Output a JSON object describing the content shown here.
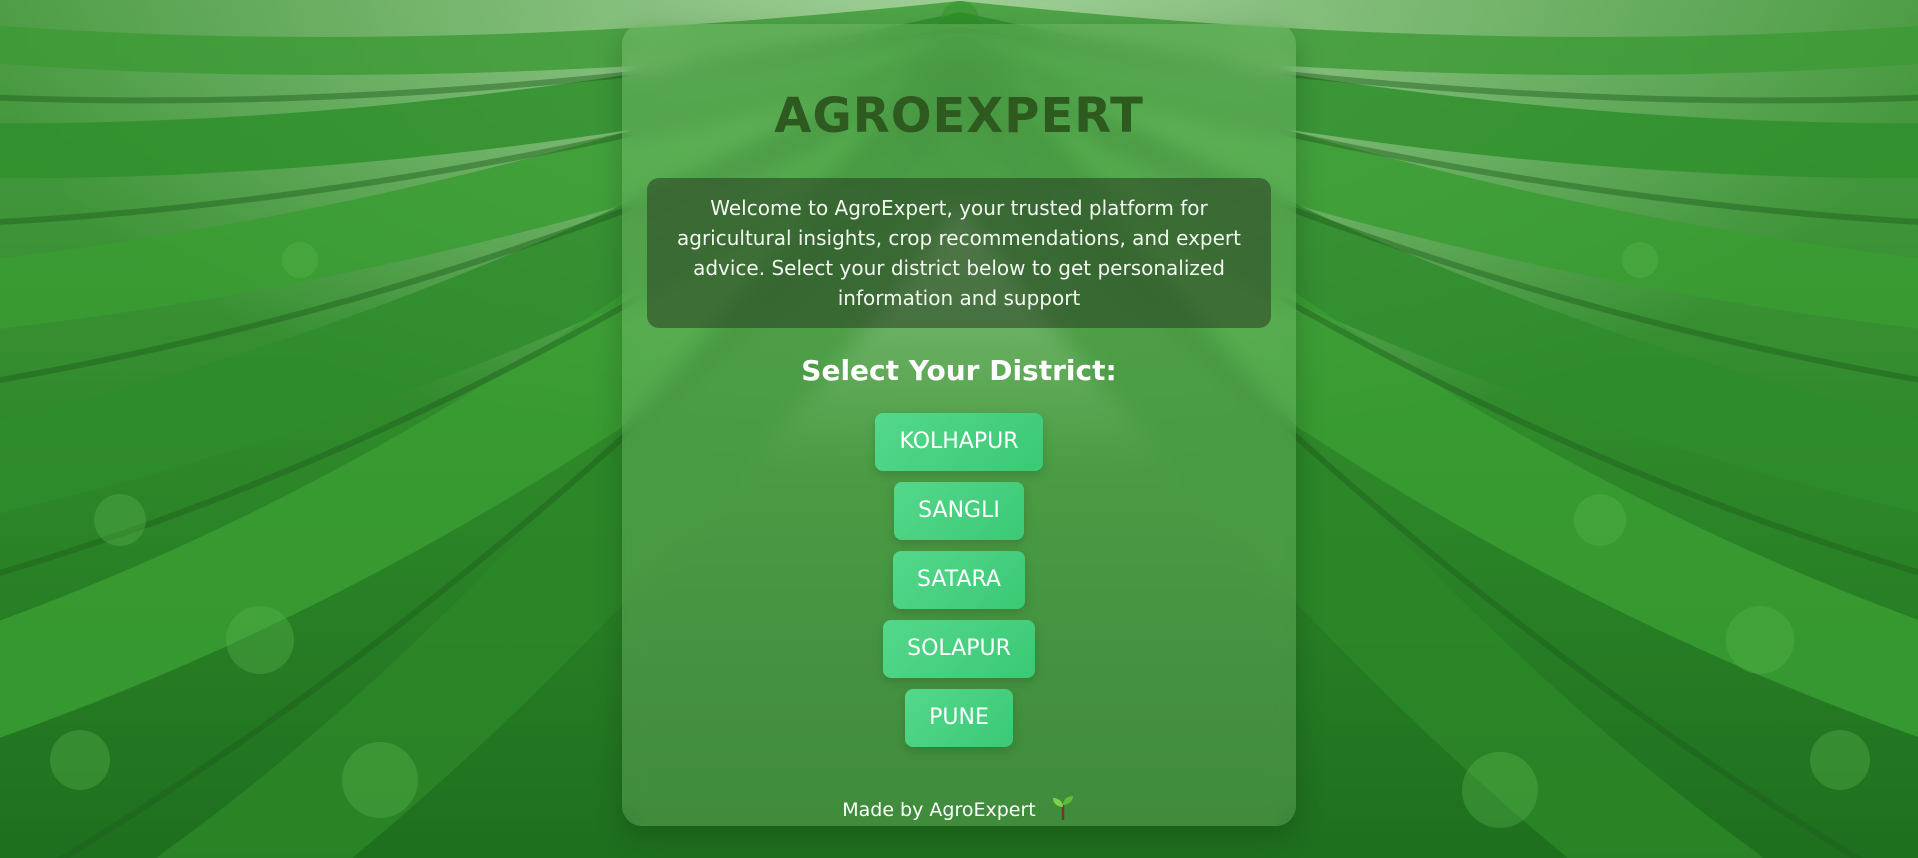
{
  "app": {
    "title": "AGROEXPERT",
    "welcome_text": "Welcome to AgroExpert, your trusted platform for agricultural insights, crop recommendations, and expert advice. Select your district below to get personalized information and support",
    "select_heading": "Select Your District:",
    "districts": [
      {
        "label": "KOLHAPUR"
      },
      {
        "label": "SANGLI"
      },
      {
        "label": "SATARA"
      },
      {
        "label": "SOLAPUR"
      },
      {
        "label": "PUNE"
      }
    ],
    "footer_text": "Made by AgroExpert",
    "footer_icon": "sprout-icon"
  },
  "colors": {
    "title": "#2e5a1f",
    "button_start": "#54d88b",
    "button_end": "#3ac975",
    "welcome_bg": "rgba(40, 60, 35, 0.55)"
  }
}
